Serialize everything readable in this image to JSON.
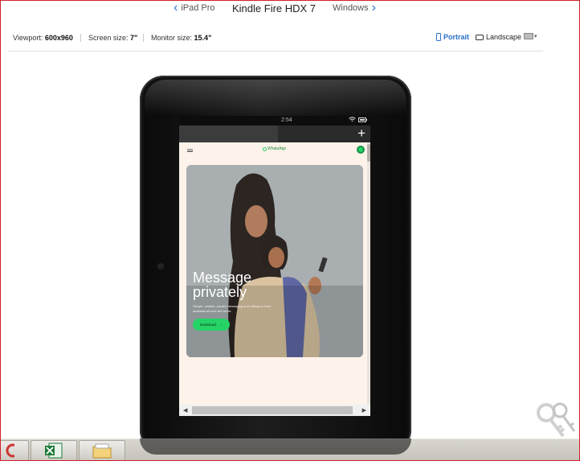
{
  "device_nav": {
    "prev_label": "iPad Pro",
    "current_label": "Kindle Fire HDX 7",
    "next_label": "Windows"
  },
  "info": {
    "viewport_label": "Viewport:",
    "viewport_value": "600x960",
    "screen_label": "Screen size:",
    "screen_value": "7\"",
    "monitor_label": "Monitor size:",
    "monitor_value": "15.4\"",
    "portrait_label": "Portrait",
    "landscape_label": "Landscape"
  },
  "tablet": {
    "status_time": "2:54",
    "tab_add": "+"
  },
  "website": {
    "logo_text": "WhatsApp",
    "hero_title": "Message privately",
    "hero_subtitle": "Simple, reliable, private messaging and calling for free*, available all over the world.",
    "cta_label": "Download",
    "cta_icon": "↓"
  },
  "colors": {
    "accent": "#2a6fc9",
    "whatsapp_green": "#25d366",
    "page_bg": "#fdf3ea"
  },
  "icons": {
    "prev": "chevron-left-icon",
    "next": "chevron-right-icon",
    "portrait": "tablet-portrait-icon",
    "landscape": "tablet-landscape-icon",
    "keys": "keys-icon",
    "excel": "excel-icon",
    "folder": "folder-icon"
  }
}
